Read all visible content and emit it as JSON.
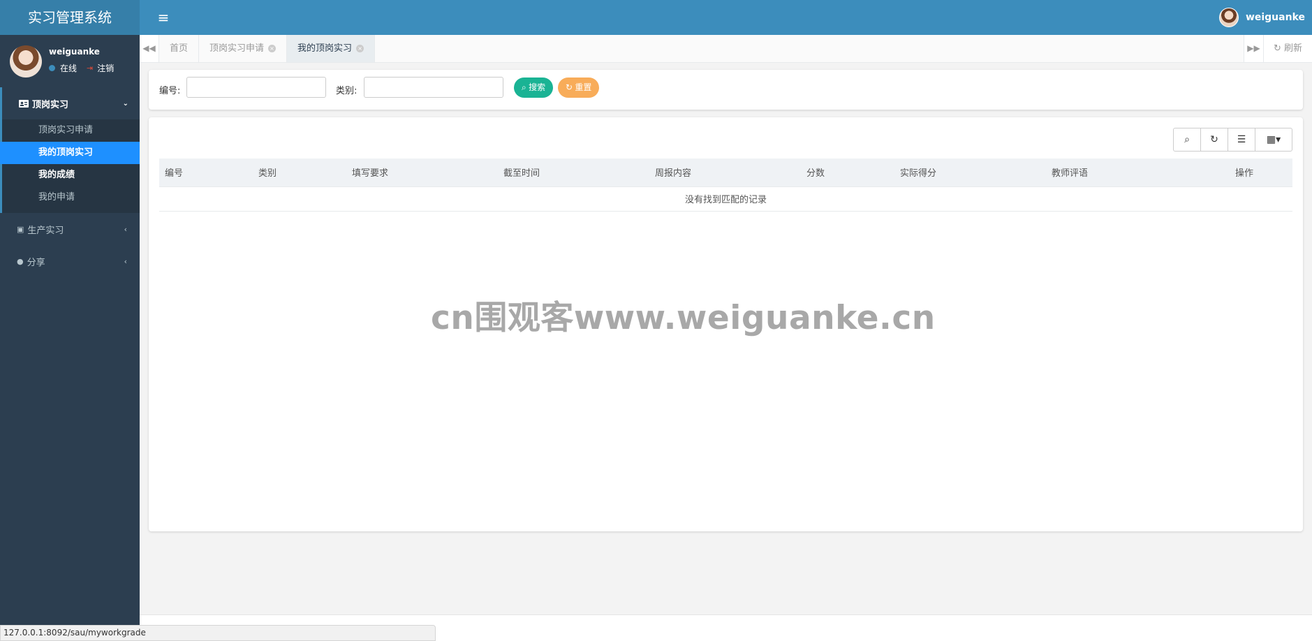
{
  "app": {
    "title": "实习管理系统"
  },
  "header": {
    "menu_icon": "hamburger-icon",
    "username": "weiguanke"
  },
  "sidebar": {
    "user": {
      "name": "weiguanke",
      "status": "在线",
      "logout": "注销"
    },
    "groups": [
      {
        "label": "顶岗实习",
        "icon": "id-card-icon",
        "expanded": true,
        "items": [
          {
            "label": "顶岗实习申请"
          },
          {
            "label": "我的顶岗实习",
            "active": true
          },
          {
            "label": "我的成绩"
          },
          {
            "label": "我的申请"
          }
        ]
      },
      {
        "label": "生产实习",
        "icon": "badge-icon",
        "expanded": false
      },
      {
        "label": "分享",
        "icon": "comment-icon",
        "expanded": false
      }
    ]
  },
  "tabs": [
    {
      "label": "首页",
      "closable": false
    },
    {
      "label": "顶岗实习申请",
      "closable": true
    },
    {
      "label": "我的顶岗实习",
      "closable": true,
      "active": true
    }
  ],
  "tab_refresh": "刷新",
  "search": {
    "fields": [
      {
        "label": "编号:",
        "value": ""
      },
      {
        "label": "类别:",
        "value": ""
      }
    ],
    "search_button": "搜索",
    "reset_button": "重置"
  },
  "table": {
    "columns": [
      "编号",
      "类别",
      "填写要求",
      "截至时间",
      "周报内容",
      "分数",
      "实际得分",
      "教师评语",
      "操作"
    ],
    "empty_message": "没有找到匹配的记录"
  },
  "watermark": "cn围观客www.weiguanke.cn",
  "status_bar": {
    "url": "127.0.0.1:8092/sau/myworkgrade"
  },
  "colors": {
    "header": "#3c8dbc",
    "sidebar": "#2c3e50",
    "active_item": "#1e90ff",
    "search_btn": "#1ab394",
    "reset_btn": "#f8ac59"
  }
}
